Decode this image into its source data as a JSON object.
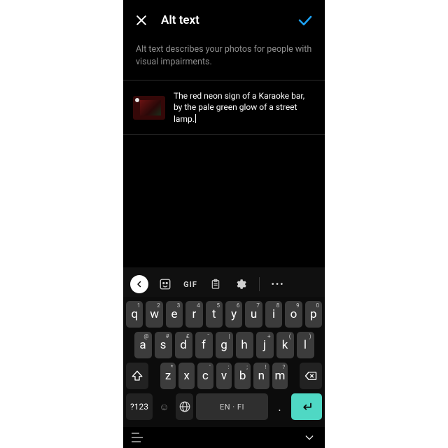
{
  "header": {
    "title": "Alt text",
    "description": "Alt text describes your photos for people with visual impairments."
  },
  "editor": {
    "value": "The red neon sign of a Karaoke bar, by the pale green glow of a street lamp."
  },
  "keyboard": {
    "toolbar": {
      "gif": "GIF",
      "more": "•••"
    },
    "rows": [
      [
        {
          "main": "q",
          "sup": "1"
        },
        {
          "main": "w",
          "sup": "2"
        },
        {
          "main": "e",
          "sup": "3"
        },
        {
          "main": "r",
          "sup": "4"
        },
        {
          "main": "t",
          "sup": "5"
        },
        {
          "main": "y",
          "sup": "6"
        },
        {
          "main": "u",
          "sup": "7"
        },
        {
          "main": "i",
          "sup": "8"
        },
        {
          "main": "o",
          "sup": "9"
        },
        {
          "main": "p",
          "sup": "0"
        }
      ],
      [
        {
          "main": "a",
          "sup": "@"
        },
        {
          "main": "s",
          "sup": "#"
        },
        {
          "main": "d",
          "sup": "£"
        },
        {
          "main": "f",
          "sup": "¯"
        },
        {
          "main": "g",
          "sup": "|"
        },
        {
          "main": "h",
          "sup": ""
        },
        {
          "main": "j",
          "sup": "+"
        },
        {
          "main": "k",
          "sup": "("
        },
        {
          "main": "l",
          "sup": ")"
        }
      ],
      [
        {
          "main": "z",
          "sup": "*"
        },
        {
          "main": "x",
          "sup": ""
        },
        {
          "main": "c",
          "sup": "'"
        },
        {
          "main": "v",
          "sup": ":"
        },
        {
          "main": "b",
          "sup": ";"
        },
        {
          "main": "n",
          "sup": "!"
        },
        {
          "main": "m",
          "sup": "?"
        }
      ]
    ],
    "bottom": {
      "symbols": "?123",
      "space": "EN · FI",
      "period": "."
    }
  }
}
